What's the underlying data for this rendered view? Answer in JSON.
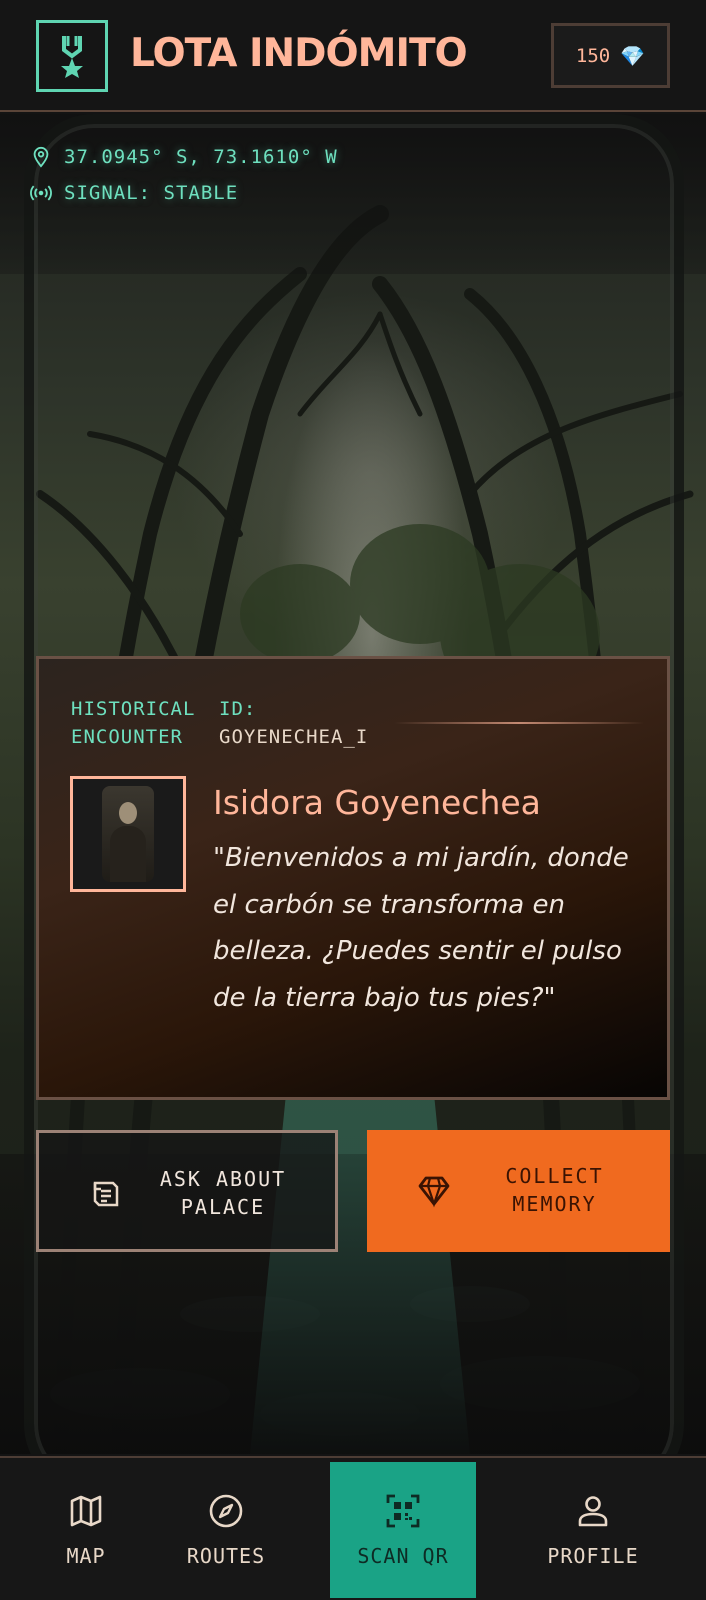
{
  "header": {
    "app_title": "LOTA INDÓMITO",
    "logo_icon": "medal-icon",
    "credits": "150",
    "credits_icon": "gem-icon"
  },
  "hud": {
    "coordinates": "37.0945° S, 73.1610° W",
    "signal": "SIGNAL: STABLE"
  },
  "encounter": {
    "label_line1": "HISTORICAL",
    "label_line2": "ENCOUNTER",
    "id_key": "ID:",
    "id_value": "GOYENECHEA_I",
    "name": "Isidora Goyenechea",
    "quote": "\"Bienvenidos a mi jardín, donde el carbón se transforma en belleza. ¿Puedes sentir el pulso de la tierra bajo tus pies?\""
  },
  "actions": {
    "ask_label_1": "ASK ABOUT",
    "ask_label_2": "PALACE",
    "collect_label_1": "COLLECT",
    "collect_label_2": "MEMORY"
  },
  "nav": {
    "items": [
      {
        "label": "MAP",
        "icon": "map-icon"
      },
      {
        "label": "ROUTES",
        "icon": "compass-icon"
      },
      {
        "label": "SCAN QR",
        "icon": "qr-icon"
      },
      {
        "label": "PROFILE",
        "icon": "user-icon"
      }
    ]
  },
  "colors": {
    "accent_teal": "#1aa386",
    "accent_orange": "#f06a1f",
    "title_peach": "#ffb69a"
  }
}
